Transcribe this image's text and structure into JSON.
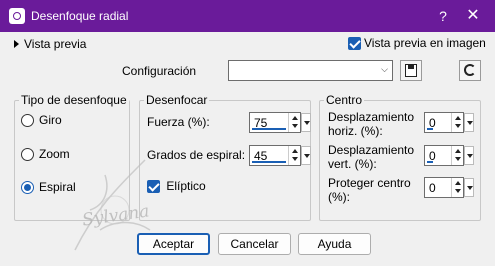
{
  "window": {
    "title": "Desenfoque radial"
  },
  "titlebar": {
    "help_label": "?",
    "close_label": "✕"
  },
  "preview": {
    "toggle_label": "Vista previa",
    "live_label": "Vista previa en imagen",
    "live_checked": true
  },
  "config": {
    "label": "Configuración",
    "value": ""
  },
  "blur_type": {
    "legend": "Tipo de desenfoque",
    "options": [
      {
        "label": "Giro",
        "checked": false
      },
      {
        "label": "Zoom",
        "checked": false
      },
      {
        "label": "Espiral",
        "checked": true
      }
    ]
  },
  "blur": {
    "legend": "Desenfocar",
    "strength_label": "Fuerza (%):",
    "strength_value": "75",
    "spiral_label": "Grados de espiral:",
    "spiral_value": "45",
    "elliptic_label": "Elíptico",
    "elliptic_checked": true
  },
  "center": {
    "legend": "Centro",
    "horiz_label_1": "Desplazamiento",
    "horiz_label_2": "horiz. (%):",
    "horiz_value": "0",
    "vert_label_1": "Desplazamiento",
    "vert_label_2": "vert. (%):",
    "vert_value": "0",
    "protect_label_1": "Proteger centro",
    "protect_label_2": "(%):",
    "protect_value": "0"
  },
  "buttons": {
    "ok": "Aceptar",
    "cancel": "Cancelar",
    "help": "Ayuda"
  },
  "watermark": {
    "text": "Sylvana"
  },
  "colors": {
    "titlebar": "#6a1b9a",
    "accent": "#1a5fb4"
  }
}
